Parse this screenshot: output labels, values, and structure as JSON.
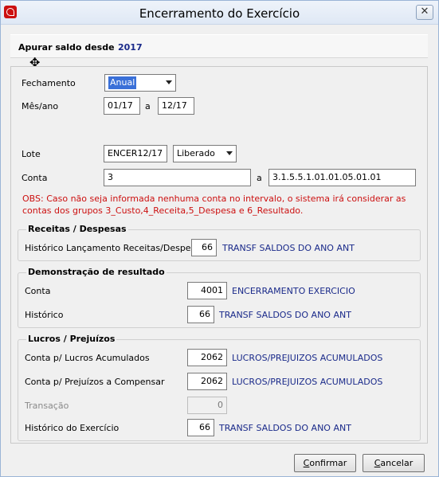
{
  "window": {
    "title": "Encerramento do Exercício",
    "close_symbol": "✕"
  },
  "header": {
    "label": "Apurar saldo desde",
    "year": "2017"
  },
  "form": {
    "fechamento": {
      "label": "Fechamento",
      "value": "Anual"
    },
    "mes_ano": {
      "label": "Mês/ano",
      "from": "01/17",
      "sep": "a",
      "to": "12/17"
    },
    "lote": {
      "label": "Lote",
      "value": "ENCER12/17",
      "status": "Liberado"
    },
    "conta": {
      "label": "Conta",
      "from": "3",
      "sep": "a",
      "to": "3.1.5.5.1.01.01.05.01.01"
    },
    "obs": "OBS: Caso não seja informada nenhuma conta no intervalo, o sistema irá considerar as contas dos grupos 3_Custo,4_Receita,5_Despesa e 6_Resultado."
  },
  "receitas": {
    "title": "Receitas / Despesas",
    "historico": {
      "label": "Histórico Lançamento Receitas/Despesas",
      "value": "66",
      "desc": "TRANSF SALDOS DO ANO ANT"
    }
  },
  "demonstracao": {
    "title": "Demonstração de resultado",
    "conta": {
      "label": "Conta",
      "value": "4001",
      "desc": "ENCERRAMENTO EXERCICIO"
    },
    "historico": {
      "label": "Histórico",
      "value": "66",
      "desc": "TRANSF SALDOS DO ANO ANT"
    }
  },
  "lucros": {
    "title": "Lucros / Prejuízos",
    "acumulados": {
      "label": "Conta p/ Lucros Acumulados",
      "value": "2062",
      "desc": "LUCROS/PREJUIZOS  ACUMULADOS"
    },
    "compensar": {
      "label": "Conta p/ Prejuízos a Compensar",
      "value": "2062",
      "desc": "LUCROS/PREJUIZOS  ACUMULADOS"
    },
    "transacao": {
      "label": "Transação",
      "value": "0"
    },
    "historico": {
      "label": "Histórico do Exercício",
      "value": "66",
      "desc": "TRANSF SALDOS DO ANO ANT"
    }
  },
  "buttons": {
    "confirmar": {
      "accel": "C",
      "rest": "onfirmar"
    },
    "cancelar": {
      "accel": "C",
      "rest": "ancelar"
    }
  }
}
